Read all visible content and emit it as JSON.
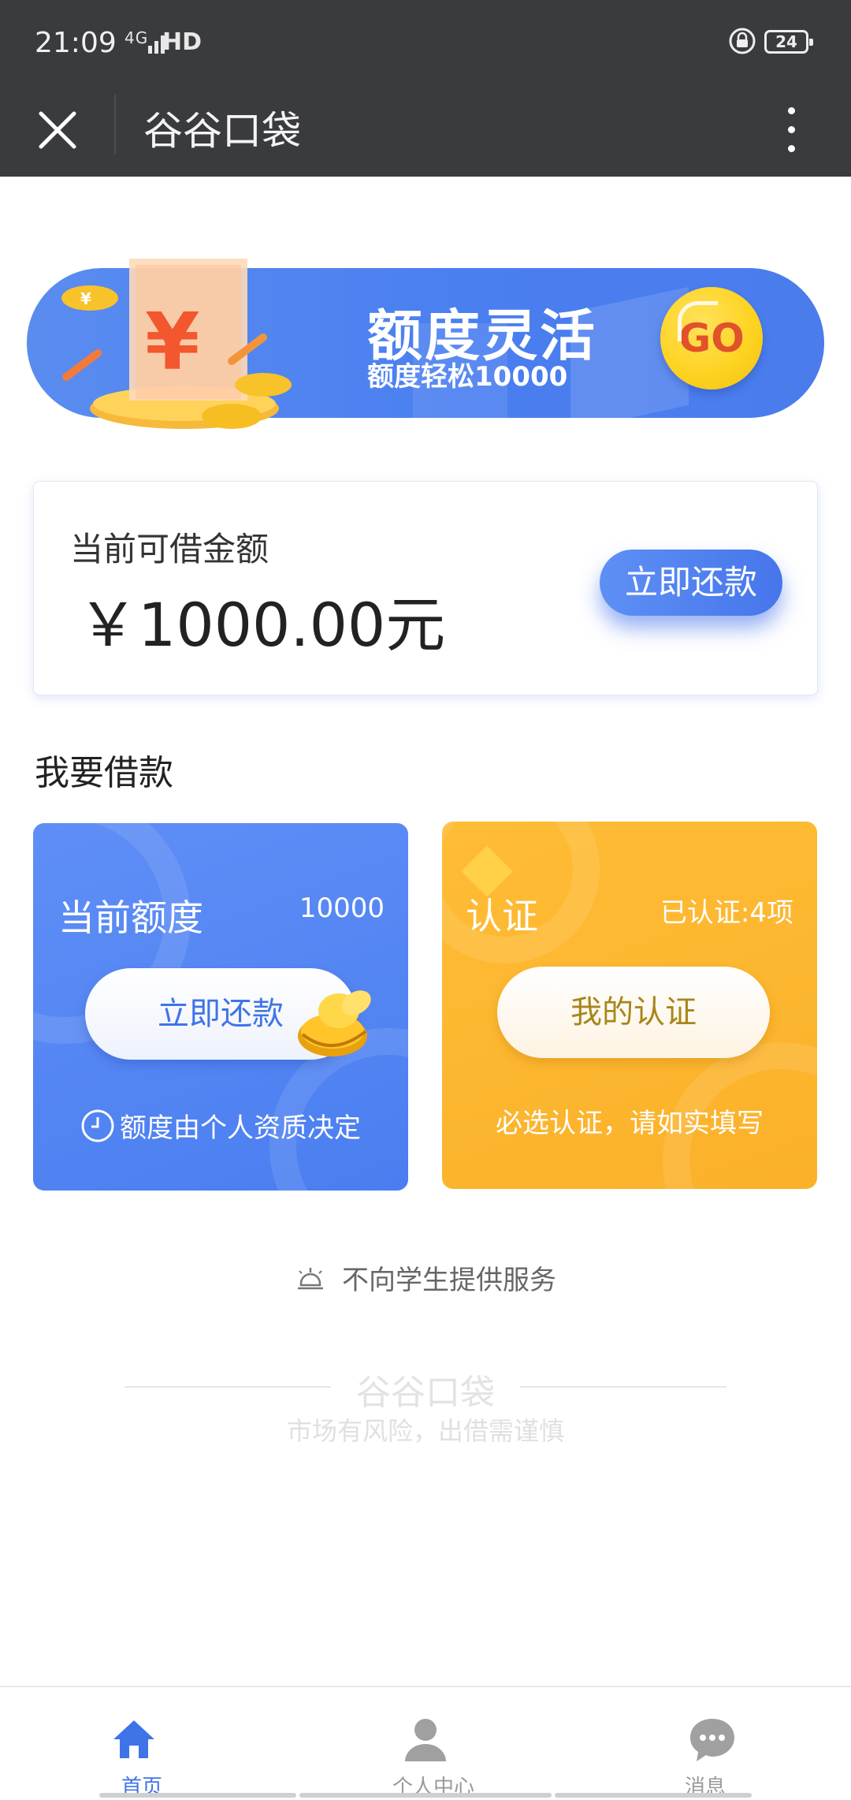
{
  "status_bar": {
    "time": "21:09",
    "network": "4G",
    "hd": "HD",
    "battery": "24"
  },
  "title_bar": {
    "title": "谷谷口袋",
    "close_icon": "close-icon",
    "more_icon": "more-vertical-icon"
  },
  "banner": {
    "title": "额度灵活",
    "subtitle": "额度轻松10000",
    "go_label": "GO",
    "accent": "#4a7ff0"
  },
  "credit_card": {
    "label": "当前可借金额",
    "amount": "￥1000.00元",
    "button_label": "立即还款"
  },
  "section": {
    "title": "我要借款"
  },
  "quota_card": {
    "heading": "当前额度",
    "value": "10000",
    "button_label": "立即还款",
    "note": "额度由个人资质决定",
    "color": "#4a7ef0"
  },
  "auth_card": {
    "heading": "认证",
    "status": "已认证:4项",
    "button_label": "我的认证",
    "note": "必选认证，请如实填写",
    "color": "#fbb12a"
  },
  "notice": {
    "text": "不向学生提供服务"
  },
  "footer": {
    "name": "谷谷口袋",
    "slogan": "市场有风险，出借需谨慎"
  },
  "tabs": [
    {
      "label": "首页",
      "icon": "home-icon",
      "active": true
    },
    {
      "label": "个人中心",
      "icon": "user-icon",
      "active": false
    },
    {
      "label": "消息",
      "icon": "message-icon",
      "active": false
    }
  ],
  "colors": {
    "active_tab": "#3f74e8",
    "inactive_tab": "#9a9a9a"
  }
}
